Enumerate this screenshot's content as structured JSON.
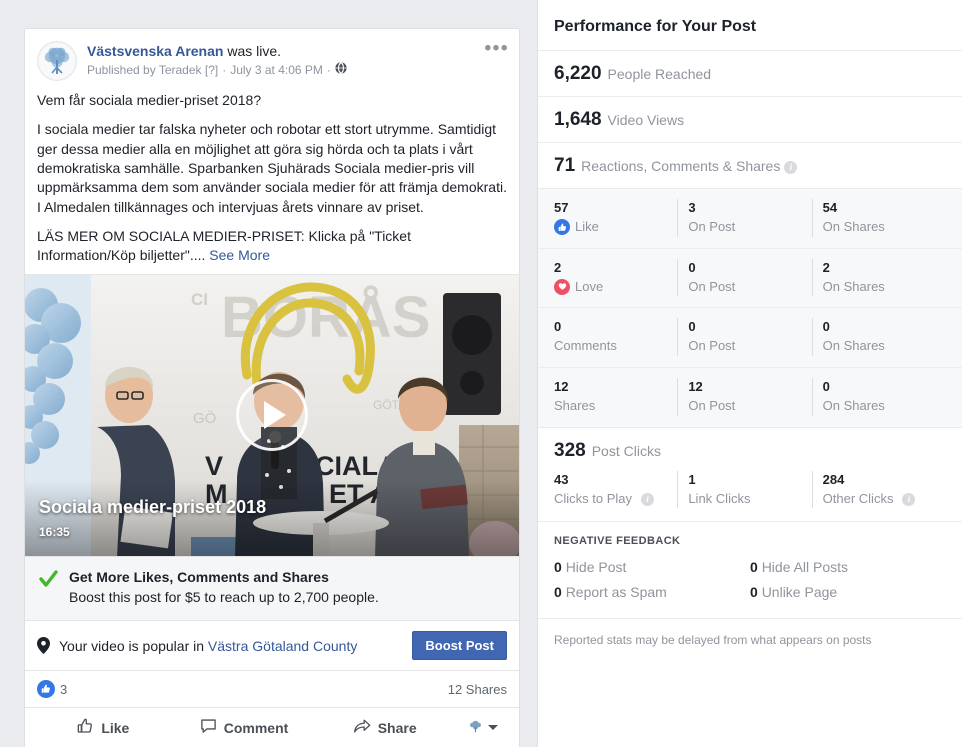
{
  "post": {
    "page_name": "Västsvenska Arenan",
    "live_suffix": "was live.",
    "meta_published": "Published by Teradek [?]",
    "meta_sep": "·",
    "meta_date": "July 3 at 4:06 PM",
    "menu_icon": "•••",
    "headline": "Vem får sociala medier-priset 2018?",
    "paragraph": "I sociala medier tar falska nyheter och robotar ett stort utrymme. Samtidigt ger dessa medier alla en möjlighet att göra sig hörda och ta plats i vårt demokratiska samhälle. Sparbanken Sjuhärads Sociala medier-pris vill uppmärksamma dem som använder sociala medier för att främja demokrati. I Almedalen tillkännages och intervjuas årets vinnare av priset.",
    "paragraph2": "LÄS MER OM SOCIALA MEDIER-PRISET: Klicka på \"Ticket Information/Köp biljetter\"....",
    "see_more": "See More",
    "video": {
      "title": "Sociala medier-priset 2018",
      "duration": "16:35"
    },
    "boost_promo": {
      "title": "Get More Likes, Comments and Shares",
      "subtitle": "Boost this post for $5 to reach up to 2,700 people."
    },
    "popular": {
      "prefix": "Your video is popular in",
      "link": "Västra Götaland County",
      "button": "Boost Post"
    },
    "counts": {
      "likes": "3",
      "shares": "12 Shares"
    },
    "actions": {
      "like": "Like",
      "comment": "Comment",
      "share": "Share"
    }
  },
  "insights": {
    "title": "Performance for Your Post",
    "headline_stats": [
      {
        "num": "6,220",
        "label": "People Reached",
        "info": false
      },
      {
        "num": "1,648",
        "label": "Video Views",
        "info": false
      },
      {
        "num": "71",
        "label": "Reactions, Comments & Shares",
        "info": true
      }
    ],
    "breakdown": [
      {
        "total": "57",
        "label": "Like",
        "icon": "thumbs-up-icon",
        "on_post": "3",
        "on_post_label": "On Post",
        "on_shares": "54",
        "on_shares_label": "On Shares"
      },
      {
        "total": "2",
        "label": "Love",
        "icon": "heart-icon",
        "on_post": "0",
        "on_post_label": "On Post",
        "on_shares": "2",
        "on_shares_label": "On Shares"
      },
      {
        "total": "0",
        "label": "Comments",
        "icon": "",
        "on_post": "0",
        "on_post_label": "On Post",
        "on_shares": "0",
        "on_shares_label": "On Shares"
      },
      {
        "total": "12",
        "label": "Shares",
        "icon": "",
        "on_post": "12",
        "on_post_label": "On Post",
        "on_shares": "0",
        "on_shares_label": "On Shares"
      }
    ],
    "post_clicks": {
      "num": "328",
      "label": "Post Clicks",
      "items": [
        {
          "num": "43",
          "label": "Clicks to Play",
          "info": true
        },
        {
          "num": "1",
          "label": "Link Clicks",
          "info": false
        },
        {
          "num": "284",
          "label": "Other Clicks",
          "info": true
        }
      ]
    },
    "negative_feedback": {
      "title": "NEGATIVE FEEDBACK",
      "items": [
        {
          "num": "0",
          "label": "Hide Post"
        },
        {
          "num": "0",
          "label": "Hide All Posts"
        },
        {
          "num": "0",
          "label": "Report as Spam"
        },
        {
          "num": "0",
          "label": "Unlike Page"
        }
      ]
    },
    "footnote": "Reported stats may be delayed from what appears on posts"
  },
  "colors": {
    "fb_blue": "#4267b2",
    "link_blue": "#365899",
    "like_blue": "#3578e5",
    "love_red": "#ed5168",
    "check_green": "#42b72a",
    "page_bg": "#e9ebee",
    "muted_text": "#90949c"
  }
}
